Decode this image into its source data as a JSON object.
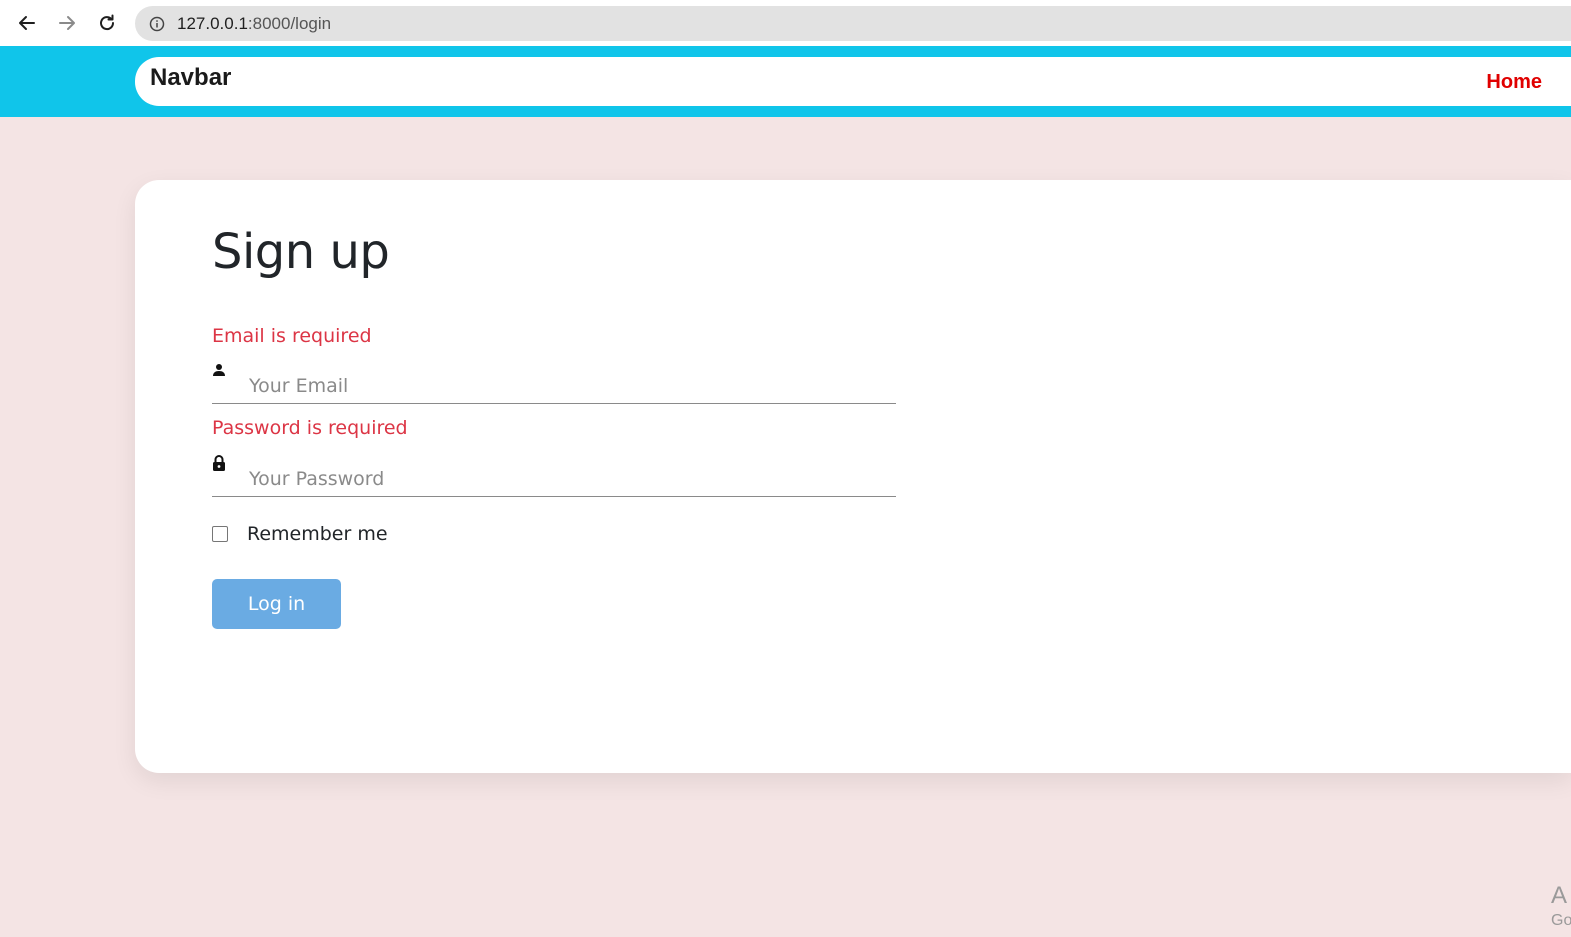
{
  "browser": {
    "url_host": "127.0.0.1",
    "url_rest": ":8000/login"
  },
  "navbar": {
    "brand": "Navbar",
    "home_label": "Home"
  },
  "form": {
    "title": "Sign up",
    "email_error": "Email is required",
    "email_placeholder": "Your Email",
    "password_error": "Password is required",
    "password_placeholder": "Your Password",
    "remember_label": "Remember me",
    "remember_checked": false,
    "login_label": "Log in"
  },
  "overlay": {
    "line1": "A",
    "line2": "Go"
  },
  "colors": {
    "navbar_band": "#10c5ea",
    "page_background": "#f4e4e4",
    "error_text": "#dc3545",
    "home_link": "#e00000",
    "login_button": "#6aabe3"
  },
  "icons": {
    "back": "arrow-left-icon",
    "forward": "arrow-right-icon",
    "reload": "reload-icon",
    "site_info": "info-icon",
    "email": "user-icon",
    "password": "lock-icon"
  }
}
